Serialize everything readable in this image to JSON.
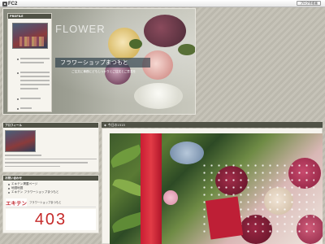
{
  "fc2bar": {
    "logo_text": "FC2",
    "create_blog_label": "ブログ作成者"
  },
  "header": {
    "bg_word": "FLOWER",
    "shop_title": "フラワーショップまつもと",
    "description": "ご注文に事務にどもしっかりとご注文とご意見を",
    "profile": {
      "heading": "PROFILE"
    }
  },
  "sidebar": {
    "profile_heading": "プロフィール",
    "links_heading": "お問い合わせ",
    "links": [
      "エキテン掲載ページ",
      "地図地図",
      "エキテン フラワーショップまつもと"
    ],
    "ekiten_logo": "エキテン",
    "ekiten_sub": "フラワーショップまつもと",
    "banner_403": "403"
  },
  "entry": {
    "diamond": "◆",
    "date_label": "今日の1515"
  },
  "colors": {
    "panel_head": "#505246",
    "panel_bg": "#f6f4ee",
    "accent_red": "#c62a2a"
  }
}
